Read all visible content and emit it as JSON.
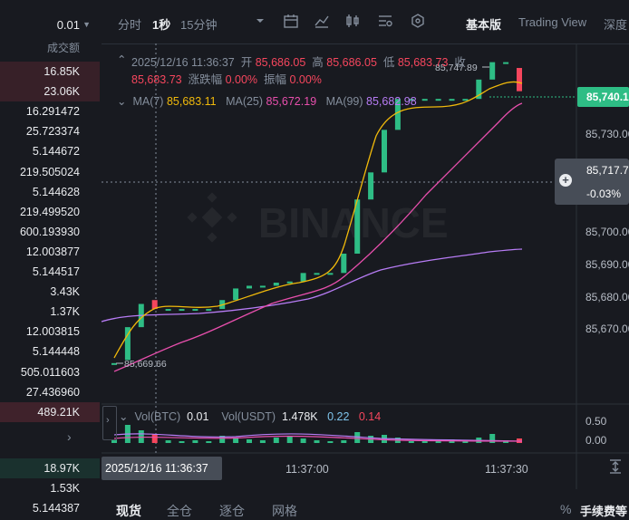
{
  "orderbook": {
    "precision": "0.01",
    "column_title": "成交额",
    "expand_arrow": "›",
    "asks": [
      "16.85K",
      "23.06K",
      "16.291472",
      "25.723374",
      "5.144672",
      "219.505024",
      "5.144628",
      "219.499520",
      "600.193930",
      "12.003877",
      "5.144517",
      "3.43K",
      "1.37K",
      "12.003815",
      "5.144448",
      "505.011603",
      "27.436960",
      "489.21K"
    ],
    "bids": [
      "18.97K",
      "1.53K",
      "5.144387"
    ]
  },
  "toolbar": {
    "items": [
      "分时",
      "1秒",
      "15分钟"
    ],
    "active": "1秒",
    "views": [
      "基本版",
      "Trading View",
      "深度"
    ]
  },
  "legend": {
    "datetime": "2025/12/16 11:36:37",
    "open_label": "开",
    "open": "85,686.05",
    "high_label": "高",
    "high": "85,686.05",
    "low_label": "低",
    "low": "85,683.73",
    "close_label": "收",
    "close": "85,683.73",
    "change_label": "涨跌幅",
    "change": "0.00%",
    "amp_label": "振幅",
    "amp": "0.00%",
    "ma7_label": "MA(7)",
    "ma7": "85,683.11",
    "ma25_label": "MA(25)",
    "ma25": "85,672.19",
    "ma99_label": "MA(99)",
    "ma99": "85,682.98"
  },
  "price_axis": {
    "labels": [
      "85,730.00",
      "85,720.00",
      "85,710.00",
      "85,700.00",
      "85,690.00",
      "85,680.00",
      "85,670.00"
    ],
    "last_price": "85,740.1",
    "crosshair_price": "85,717.7",
    "crosshair_change": "-0.03%",
    "high_marker": "85,747.89",
    "low_marker": "85,669.66"
  },
  "volume": {
    "vol_btc_label": "Vol(BTC)",
    "vol_btc": "0.01",
    "vol_usdt_label": "Vol(USDT)",
    "vol_usdt": "1.478K",
    "ma1": "0.22",
    "ma2": "0.14",
    "axis": [
      "0.50",
      "0.00"
    ]
  },
  "time_axis": {
    "crosshair_time": "2025/12/16 11:36:37",
    "labels": [
      "11:37:00",
      "11:37:30"
    ]
  },
  "watermark": "BINANCE",
  "bottom_tabs": [
    "现货",
    "全仓",
    "逐仓",
    "网格"
  ],
  "bottom_right": "手续费等",
  "colors": {
    "up": "#2ebd85",
    "down": "#f6465d",
    "ma7": "#f0b90b",
    "ma25": "#e84fad",
    "ma99": "#b77cf5",
    "bg": "#181a20"
  }
}
